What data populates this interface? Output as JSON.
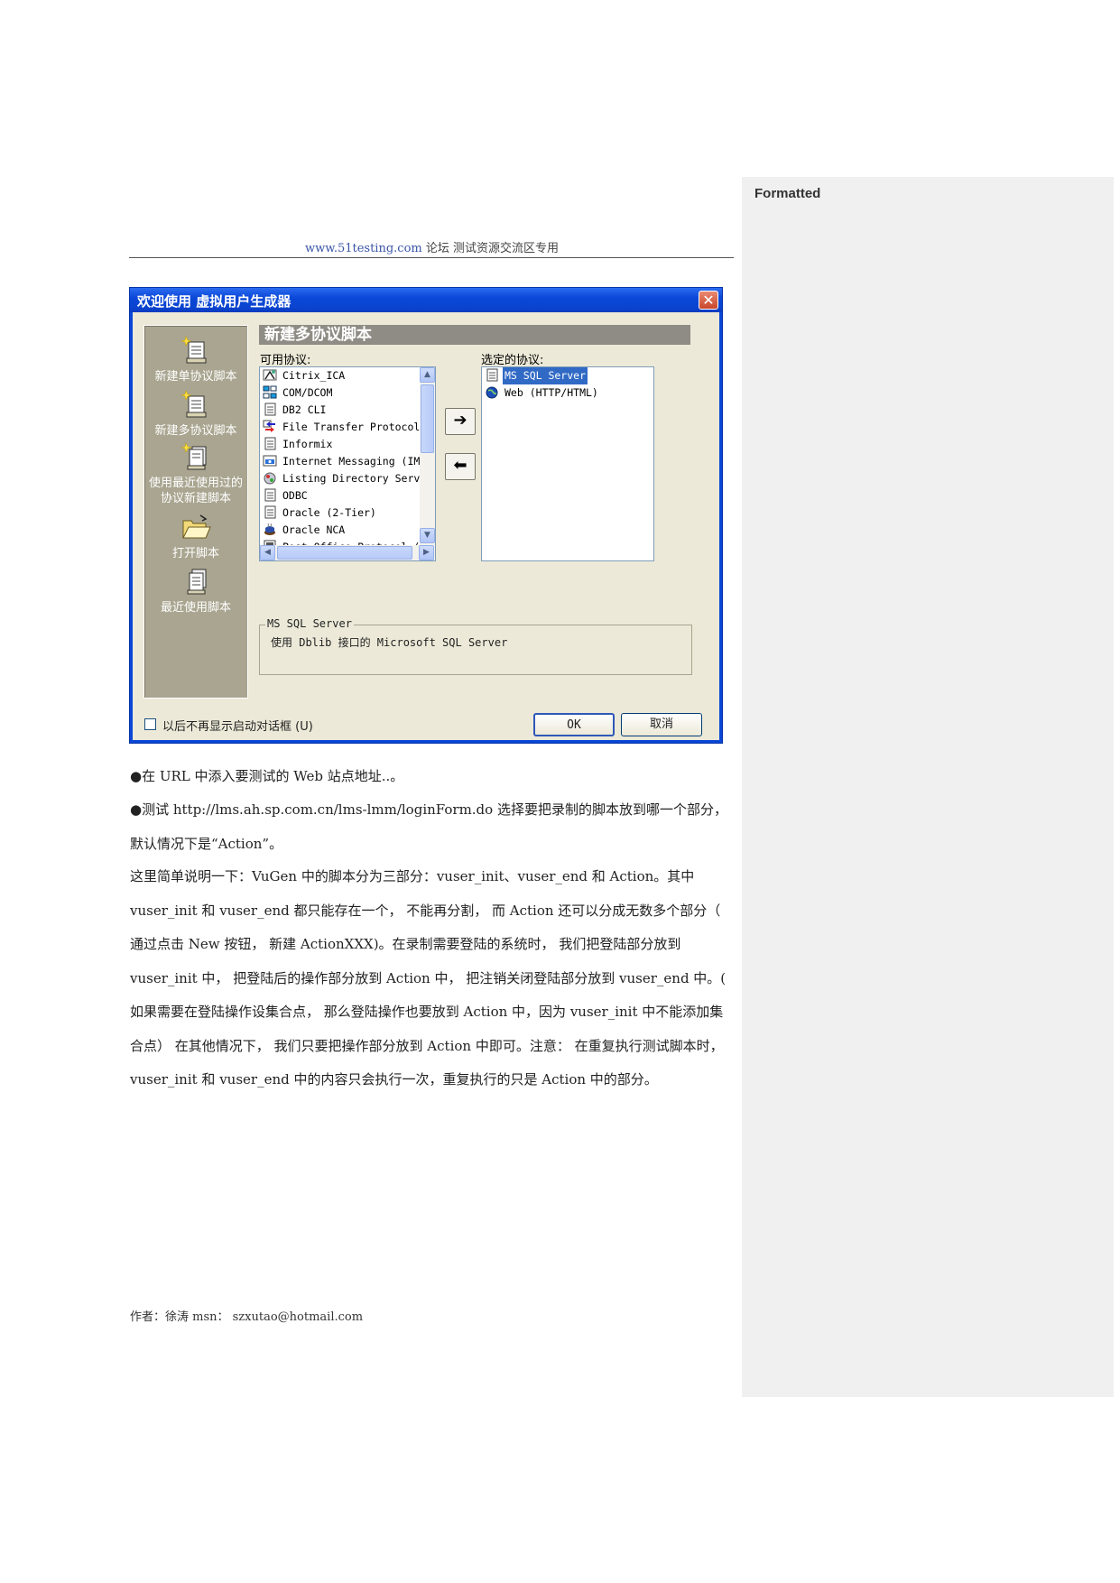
{
  "comment_pane": {
    "label": "Formatted"
  },
  "header": {
    "site": "www.51testing.com",
    "text": " 论坛 测试资源交流区专用"
  },
  "dialog": {
    "title": "欢迎使用 虚拟用户生成器",
    "close": "✕",
    "sidebar": [
      {
        "label": "新建单协议脚本",
        "icon": "scroll-new-icon"
      },
      {
        "label": "新建多协议脚本",
        "icon": "scroll-multi-icon"
      },
      {
        "label": "使用最近使用过的协议新建脚本",
        "icon": "scroll-stack-icon"
      },
      {
        "label": "打开脚本",
        "icon": "folder-open-icon"
      },
      {
        "label": "最近使用脚本",
        "icon": "recent-scripts-icon"
      }
    ],
    "section_title": "新建多协议脚本",
    "available_label": "可用协议:",
    "selected_label": "选定的协议:",
    "available": [
      "Citrix_ICA",
      "COM/DCOM",
      "DB2 CLI",
      "File Transfer Protocol.",
      "Informix",
      "Internet Messaging (IMA",
      "Listing Directory Serv.",
      "ODBC",
      "Oracle (2-Tier)",
      "Oracle NCA",
      "Post Office Protocol ("
    ],
    "selected": [
      "MS SQL Server",
      "Web (HTTP/HTML)"
    ],
    "add_arrow": "➔",
    "remove_arrow": "⬅",
    "group_title": "MS SQL Server",
    "group_desc": "使用 Dblib 接口的 Microsoft SQL Server",
    "checkbox_label": "以后不再显示启动对话框 (U)",
    "ok": "OK",
    "cancel": "取消",
    "colors": {
      "title_bar": "#0a47d6",
      "client": "#ece9d8",
      "selection": "#316ac5"
    }
  },
  "body": {
    "p1": "●在 URL 中添入要测试的 Web 站点地址..。",
    "p2": "●测试 http://lms.ah.sp.com.cn/lms-lmm/loginForm.do 选择要把录制的脚本放到哪一个部分，默认情况下是“Action”。",
    "p3": "这里简单说明一下：VuGen 中的脚本分为三部分：vuser_init、vuser_end 和 Action。其中 vuser_init 和 vuser_end 都只能存在一个， 不能再分割， 而 Action 还可以分成无数多个部分（ 通过点击 New 按钮， 新建 ActionXXX)。在录制需要登陆的系统时， 我们把登陆部分放到 vuser_init 中， 把登陆后的操作部分放到 Action 中， 把注销关闭登陆部分放到 vuser_end 中。( 如果需要在登陆操作设集合点， 那么登陆操作也要放到 Action 中，因为 vuser_init 中不能添加集合点） 在其他情况下， 我们只要把操作部分放到 Action 中即可。注意： 在重复执行测试脚本时，vuser_init 和 vuser_end 中的内容只会执行一次，重复执行的只是 Action 中的部分。"
  },
  "footer": "作者：徐涛 msn： szxutao@hotmail.com"
}
